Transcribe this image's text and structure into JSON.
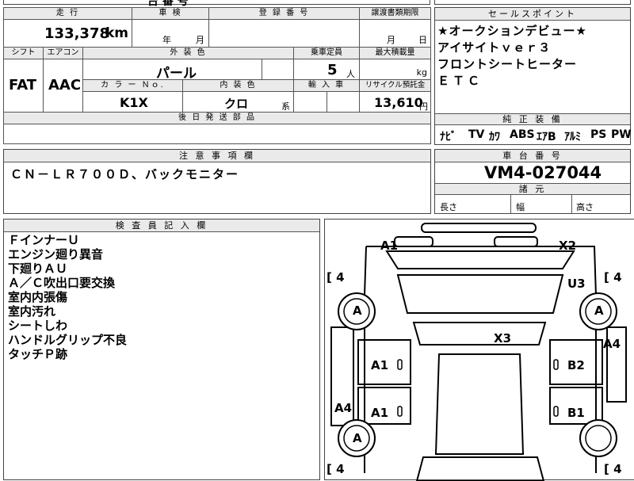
{
  "top_fragment": "台 番 号",
  "vehicle": {
    "mileage_header": "走 行",
    "mileage": "133,378",
    "mileage_unit": "km",
    "inspection_header": "車 検",
    "insp_year_unit": "年",
    "insp_month_unit": "月",
    "registration_header": "登 録 番 号",
    "transfer_header": "譲渡書類期限",
    "transfer_month_unit": "月",
    "transfer_day_unit": "日",
    "shift_header": "シフト",
    "shift": "FAT",
    "aircon_header": "エアコン",
    "aircon": "AAC",
    "exterior_header": "外 装 色",
    "exterior": "パール",
    "capacity_header": "乗車定員",
    "capacity": "5",
    "capacity_unit": "人",
    "max_load_header": "最大積載量",
    "max_load_unit": "kg",
    "color_no_header": "カ ラ ー Ｎｏ.",
    "color_no": "K1X",
    "interior_header": "内 装 色",
    "interior": "クロ",
    "interior_suffix": "系",
    "import_header": "輸 入 車",
    "recycle_header": "リサイクル預託金",
    "recycle": "13,610",
    "recycle_unit": "円",
    "parts_header": "後 日 発 送 部 品"
  },
  "sales_points": {
    "header": "セールスポイント",
    "lines": [
      "★オークションデビュー★",
      "アイサイトｖｅｒ３",
      "フロントシートヒーター",
      "ＥＴＣ"
    ],
    "equipment_header": "純 正 装 備",
    "equipment": [
      "ﾅﾋﾞ",
      "TV",
      "ｶﾜ",
      "ABS",
      "ｴｱB",
      "ｱﾙﾐ",
      "PS",
      "PW"
    ]
  },
  "notes": {
    "header": "注 意 事 項 欄",
    "text": "ＣＮ－ＬＲ７００Ｄ、バックモニター"
  },
  "chassis": {
    "header": "車 台 番 号",
    "number": "VM4-027044"
  },
  "dimensions": {
    "header": "諸 元",
    "length": "長さ",
    "width": "幅",
    "height": "高さ"
  },
  "inspector": {
    "header": "検 査 員 記 入 欄",
    "lines": [
      "ＦインナーＵ",
      "エンジン廻り異音",
      "下廻りＡＵ",
      "Ａ／Ｃ吹出口要交換",
      "室内内張傷",
      "室内汚れ",
      "シートしわ",
      "ハンドルグリップ不良",
      "タッチＰ跡"
    ]
  },
  "diagram": {
    "tire_fl": "4",
    "tire_fr": "4",
    "tire_rl": "4",
    "tire_rr": "4",
    "marks": {
      "front_left_corner": "A1",
      "front_right_corner": "X2",
      "right_fender": "U3",
      "roof": "X3",
      "right_rear_quarter": "A4",
      "left_front_door": "A1",
      "right_front_door": "B2",
      "left_rear_quarter": "A4",
      "left_rear_door": "A1",
      "right_rear_door": "B1",
      "wheel_fl": "A",
      "wheel_fr": "A",
      "wheel_rl": "A"
    }
  }
}
